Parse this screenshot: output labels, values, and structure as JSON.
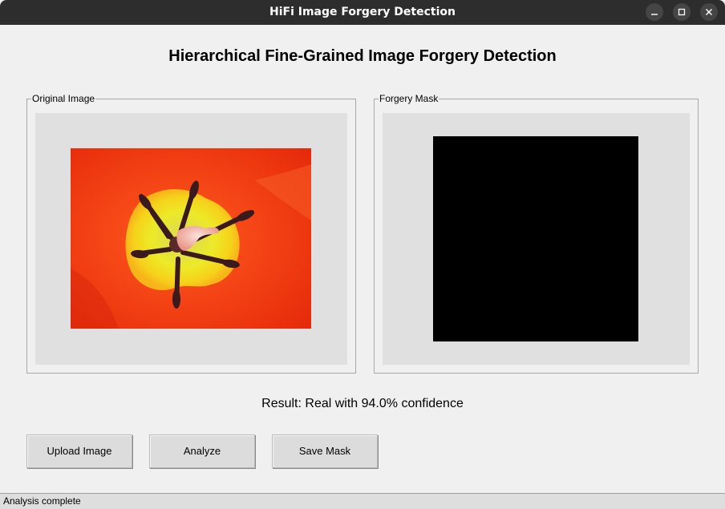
{
  "window": {
    "title": "HiFi Image Forgery Detection",
    "controls": [
      "minimize",
      "maximize",
      "close"
    ]
  },
  "heading": "Hierarchical Fine-Grained Image Forgery Detection",
  "panels": {
    "original": {
      "label": "Original Image"
    },
    "mask": {
      "label": "Forgery Mask"
    }
  },
  "result": {
    "text": "Result: Real with 94.0% confidence"
  },
  "buttons": {
    "upload": "Upload Image",
    "analyze": "Analyze",
    "save": "Save Mask"
  },
  "status": {
    "text": "Analysis complete"
  },
  "icons": {
    "minimize": "minimize-icon",
    "maximize": "maximize-icon",
    "close": "close-icon"
  },
  "colors": {
    "titlebar": "#2d2d2d",
    "background": "#f0f0f0",
    "canvas": "#e0e0e0",
    "mask": "#000000"
  }
}
